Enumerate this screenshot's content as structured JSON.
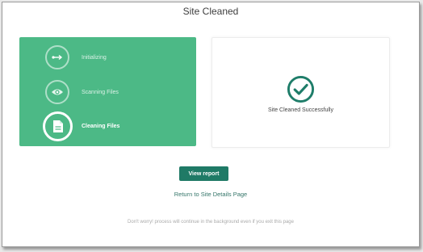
{
  "page": {
    "title": "Site Cleaned"
  },
  "steps": [
    {
      "label": "Initializing",
      "icon": "arrows-horizontal-icon",
      "state": "done"
    },
    {
      "label": "Scanning Files",
      "icon": "eye-icon",
      "state": "done"
    },
    {
      "label": "Cleaning Files",
      "icon": "document-icon",
      "state": "active"
    }
  ],
  "result": {
    "message": "Site Cleaned Successfully",
    "icon": "check-circle-icon"
  },
  "actions": {
    "view_report": "View report",
    "return_link": "Return to Site Details Page"
  },
  "footer": {
    "note": "Don't worry! process will continue in the background even if you exit this page"
  },
  "colors": {
    "panel_green": "#4cb986",
    "button_dark_green": "#1f7a66",
    "check_green": "#1e7d69",
    "link_green": "#35766a"
  }
}
